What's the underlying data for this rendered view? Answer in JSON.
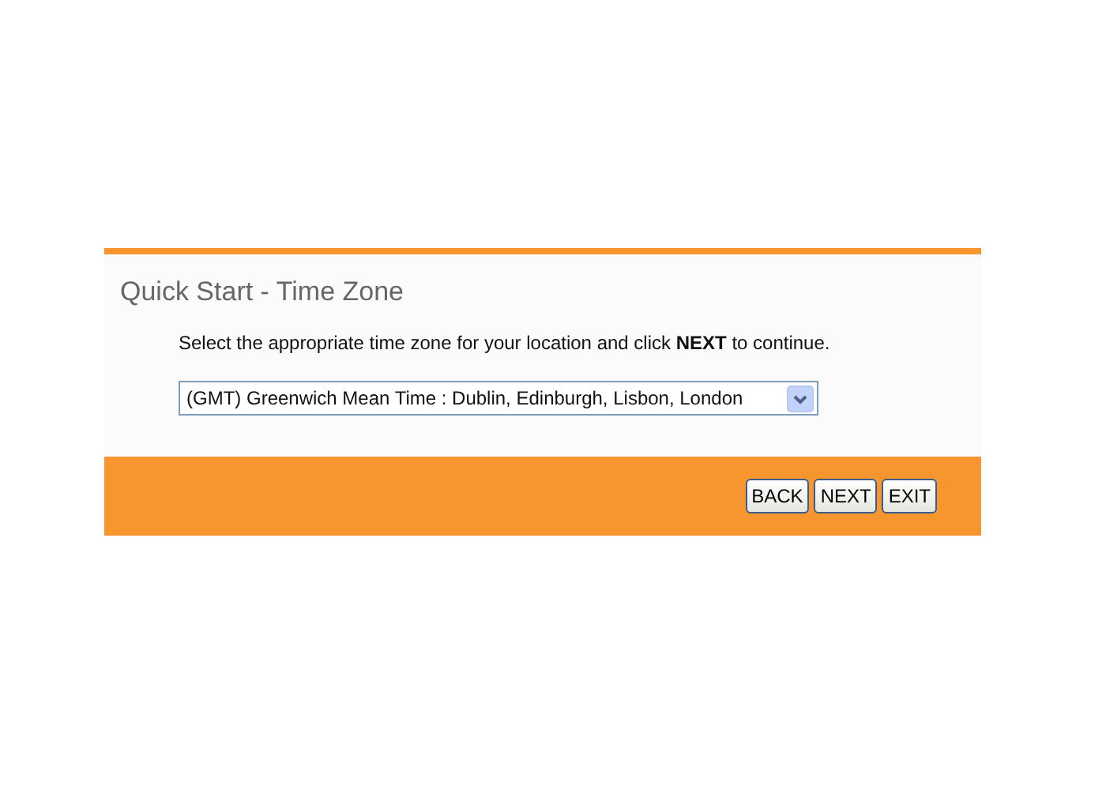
{
  "title": "Quick Start - Time Zone",
  "instruction": "Select the appropriate time zone for your location and click **NEXT** to continue.",
  "time_zone_select": {
    "value": "(GMT) Greenwich Mean Time : Dublin, Edinburgh, Lisbon, London"
  },
  "buttons": [
    {
      "label": "BACK"
    },
    {
      "label": "NEXT"
    },
    {
      "label": "EXIT"
    }
  ]
}
